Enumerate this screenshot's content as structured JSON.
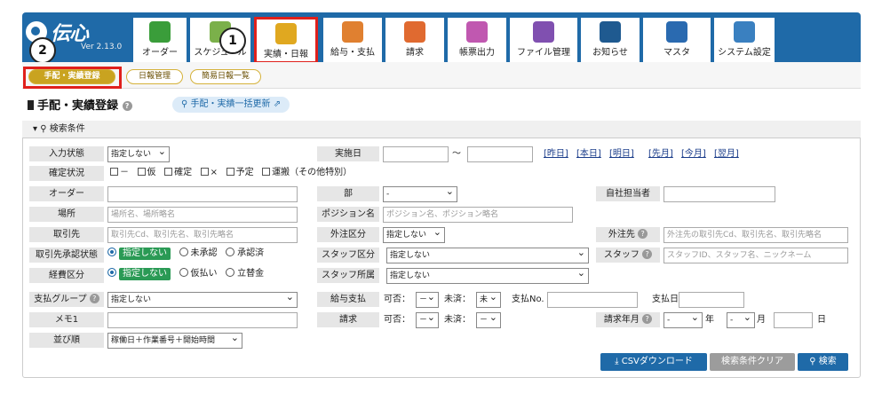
{
  "logo": {
    "name": "伝心",
    "version": "Ver 2.13.0"
  },
  "nav": [
    "オーダー",
    "スケジュール",
    "実績・日報",
    "給与・支払",
    "請求",
    "帳票出力",
    "ファイル管理",
    "お知らせ",
    "マスタ",
    "システム設定"
  ],
  "markers": [
    "1",
    "2"
  ],
  "subtabs": [
    "手配・実績登録",
    "日報管理",
    "簡易日報一覧"
  ],
  "page": {
    "title": "手配・実績登録",
    "bulk": "手配・実績一括更新"
  },
  "panel": {
    "title": "検索条件"
  },
  "labels": {
    "entry_state": "入力状態",
    "confirm_state": "確定状況",
    "order": "オーダー",
    "place": "場所",
    "client": "取引先",
    "client_approval": "取引先承認状態",
    "expense": "経費区分",
    "pay_group": "支払グループ",
    "memo1": "メモ1",
    "sort": "並び順",
    "impl_date": "実施日",
    "dept": "部",
    "position": "ポジション名",
    "outsource_type": "外注区分",
    "staff_type": "スタッフ区分",
    "staff_dept": "スタッフ所属",
    "salary": "給与支払",
    "billing": "請求",
    "own_staff": "自社担当者",
    "outsource": "外注先",
    "staff": "スタッフ",
    "bill_month": "請求年月"
  },
  "values": {
    "entry_state": "指定しない",
    "dept": "-",
    "outsource_type": "指定しない",
    "staff_type": "指定しない",
    "staff_dept": "指定しない",
    "pay_group": "指定しない",
    "sort": "稼働日＋作業番号＋開始時間",
    "salary_yesno": "－",
    "salary_unpaid": "未",
    "billing_yesno": "－",
    "billing_unpaid": "－",
    "year": "-",
    "month": "-"
  },
  "placeholders": {
    "place": "場所名、場所略名",
    "client": "取引先Cd、取引先名、取引先略名",
    "position": "ポジション名、ポジション略名",
    "outsource": "外注先の取引先Cd、取引先名、取引先略名",
    "staff": "スタッフID、スタッフ名、ニックネーム"
  },
  "confirm": [
    "－",
    "仮",
    "確定",
    "×",
    "予定",
    "運搬（その他特別）"
  ],
  "approval": [
    "指定しない",
    "未承認",
    "承認済"
  ],
  "expense_opts": [
    "指定しない",
    "仮払い",
    "立替金"
  ],
  "text": {
    "tilde": "～",
    "yesno": "可否：",
    "unpaid": "未済：",
    "payno": "支払No.",
    "paydate": "支払日",
    "year": "年",
    "month": "月",
    "day": "日"
  },
  "date_links": [
    "[昨日]",
    "[本日]",
    "[明日]",
    "[先月]",
    "[今月]",
    "[翌月]"
  ],
  "buttons": {
    "csv": "CSVダウンロード",
    "clear": "検索条件クリア",
    "search": "検索"
  }
}
